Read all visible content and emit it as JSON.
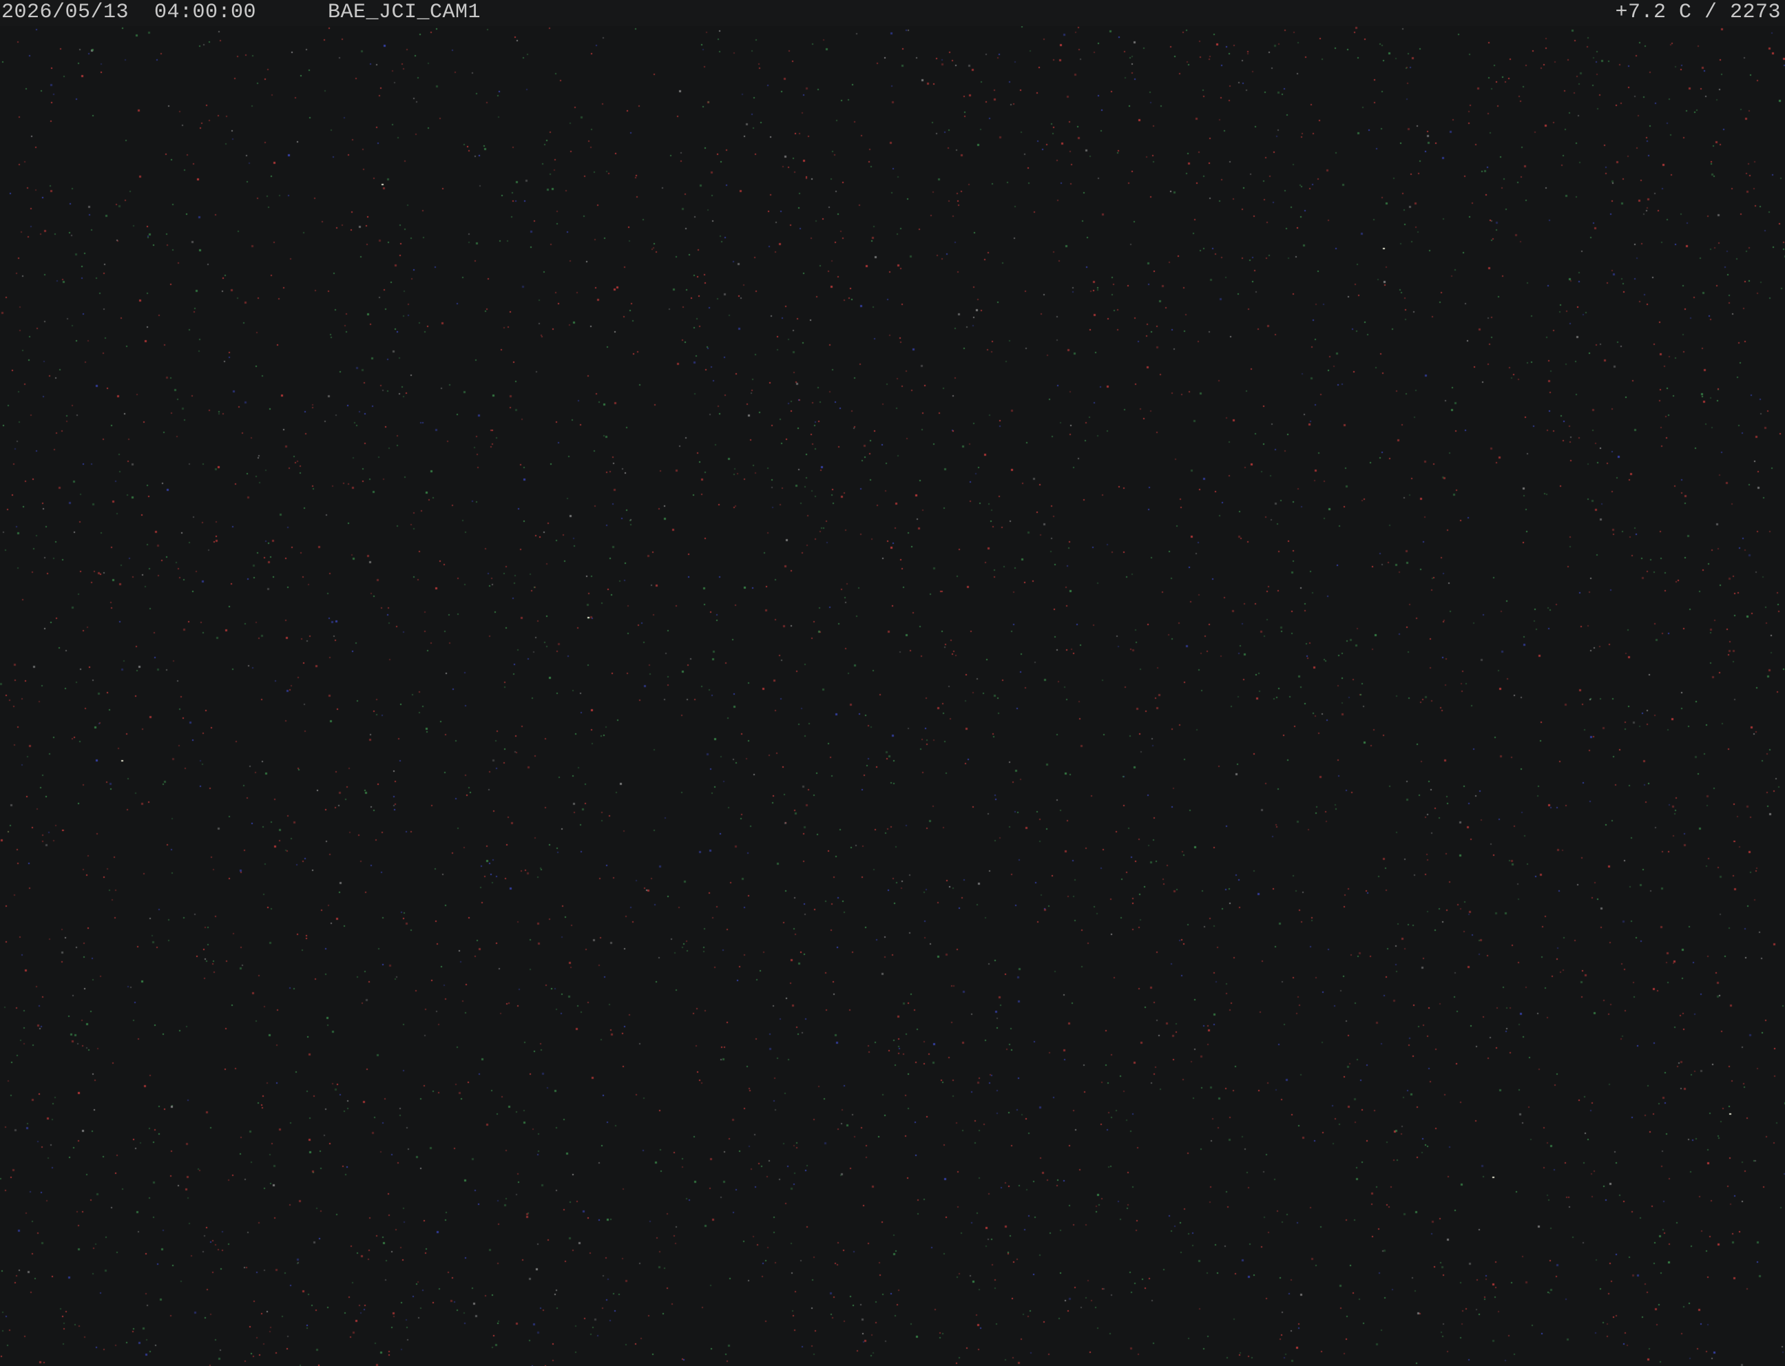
{
  "osd": {
    "datetime": "2026/05/13  04:00:00",
    "camera_id": "BAE_JCI_CAM1",
    "temperature_reading": "+7.2 C / 2273"
  },
  "scene": {
    "description_color": "#141516",
    "noise_colors": [
      "#c23a3a",
      "#3a8a4a",
      "#3a46b8",
      "#8a8a8a"
    ]
  }
}
